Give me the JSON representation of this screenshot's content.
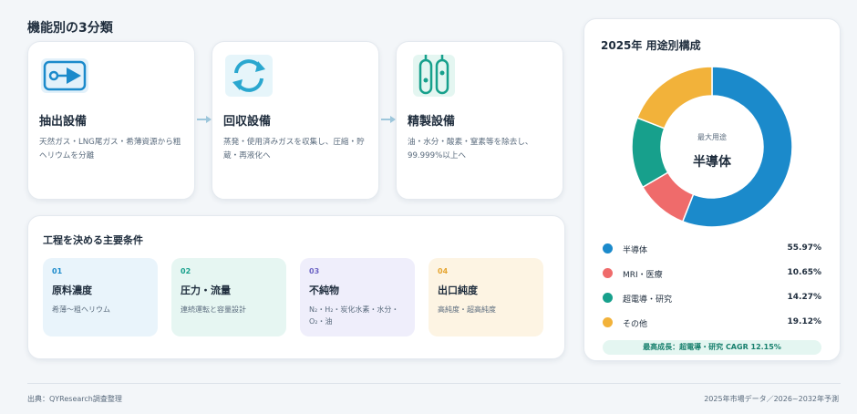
{
  "section_title": "機能別の3分類",
  "functions": [
    {
      "title": "抽出設備",
      "desc": "天然ガス・LNG尾ガス・希薄資源から粗ヘリウムを分離",
      "icon": "extraction-icon"
    },
    {
      "title": "回収設備",
      "desc": "蒸発・使用済みガスを収集し、圧縮・貯蔵・再液化へ",
      "icon": "recycle-icon"
    },
    {
      "title": "精製設備",
      "desc": "油・水分・酸素・窒素等を除去し、99.999%以上へ",
      "icon": "purification-icon"
    }
  ],
  "conditions": {
    "title": "工程を決める主要条件",
    "items": [
      {
        "num": "01",
        "title": "原料濃度",
        "desc": "希薄〜粗ヘリウム",
        "color": "#1b8acb",
        "bg": "#e9f4fb"
      },
      {
        "num": "02",
        "title": "圧力・流量",
        "desc": "連続運転と容量設計",
        "color": "#17a08c",
        "bg": "#e6f6f2"
      },
      {
        "num": "03",
        "title": "不純物",
        "desc": "N₂・H₂・炭化水素・水分・O₂・油",
        "color": "#6c63c4",
        "bg": "#efeefb"
      },
      {
        "num": "04",
        "title": "出口純度",
        "desc": "高純度・超高純度",
        "color": "#e6a530",
        "bg": "#fdf4e3"
      }
    ]
  },
  "composition": {
    "title": "2025年 用途別構成",
    "center_sub": "最大用途",
    "center_main": "半導体",
    "highlight": "最高成長：超電導・研究 CAGR 12.15%"
  },
  "chart_data": {
    "type": "pie",
    "title": "2025年 用途別構成",
    "series": [
      {
        "name": "半導体",
        "value": 55.97,
        "label": "55.97%",
        "color": "#1b8acb"
      },
      {
        "name": "MRI・医療",
        "value": 10.65,
        "label": "10.65%",
        "color": "#ef6b6b"
      },
      {
        "name": "超電導・研究",
        "value": 14.27,
        "label": "14.27%",
        "color": "#17a08c"
      },
      {
        "name": "その他",
        "value": 19.12,
        "label": "19.12%",
        "color": "#f2b23a"
      }
    ],
    "legend_placement": "bottom"
  },
  "footer": {
    "source": "出典：QYResearch調査整理",
    "note": "2025年市場データ／2026~2032年予測"
  }
}
